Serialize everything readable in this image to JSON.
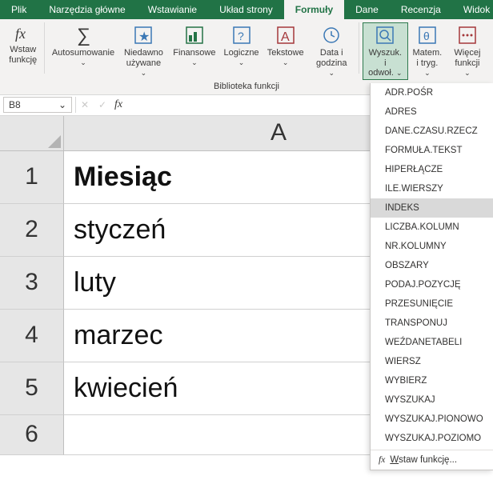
{
  "tabs": {
    "t0": "Plik",
    "t1": "Narzędzia główne",
    "t2": "Wstawianie",
    "t3": "Układ strony",
    "t4": "Formuły",
    "t5": "Dane",
    "t6": "Recenzja",
    "t7": "Widok"
  },
  "ribbon": {
    "insert_fn": {
      "l1": "Wstaw",
      "l2": "funkcję"
    },
    "autosum": "Autosumowanie",
    "recent": {
      "l1": "Niedawno",
      "l2": "używane"
    },
    "financial": "Finansowe",
    "logical": "Logiczne",
    "text": "Tekstowe",
    "datetime": {
      "l1": "Data i",
      "l2": "godzina"
    },
    "lookup": {
      "l1": "Wyszuk. i",
      "l2": "odwoł."
    },
    "math": {
      "l1": "Matem.",
      "l2": "i tryg."
    },
    "more": {
      "l1": "Więcej",
      "l2": "funkcji"
    },
    "group": "Biblioteka funkcji"
  },
  "namebox": "B8",
  "colA": "A",
  "rows": [
    "1",
    "2",
    "3",
    "4",
    "5",
    "6"
  ],
  "cells": [
    "Miesiąc",
    "styczeń",
    "luty",
    "marzec",
    "kwiecień",
    ""
  ],
  "dropdown": {
    "items": [
      "ADR.POŚR",
      "ADRES",
      "DANE.CZASU.RZECZ",
      "FORMUŁA.TEKST",
      "HIPERŁĄCZE",
      "ILE.WIERSZY",
      "INDEKS",
      "LICZBA.KOLUMN",
      "NR.KOLUMNY",
      "OBSZARY",
      "PODAJ.POZYCJĘ",
      "PRZESUNIĘCIE",
      "TRANSPONUJ",
      "WEŹDANETABELI",
      "WIERSZ",
      "WYBIERZ",
      "WYSZUKAJ",
      "WYSZUKAJ.PIONOWO",
      "WYSZUKAJ.POZIOMO"
    ],
    "highlight": 6,
    "footer": "Wstaw funkcję..."
  }
}
